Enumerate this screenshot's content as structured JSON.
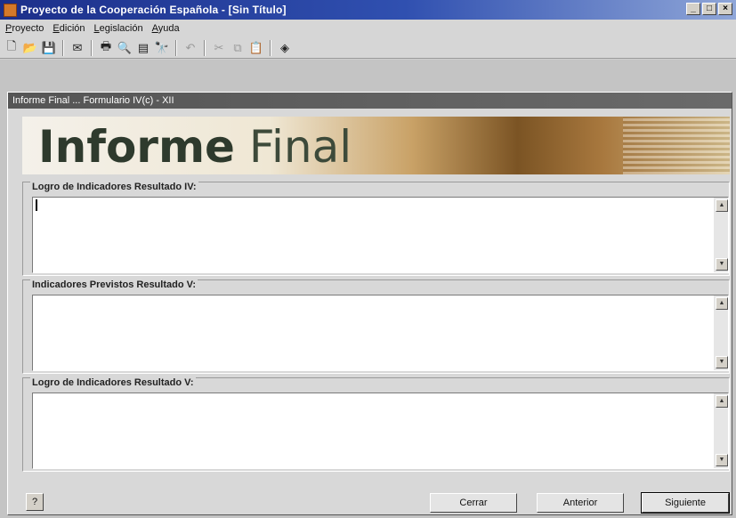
{
  "app": {
    "title": "Proyecto de la Cooperación Española - [Sin Título]"
  },
  "window_buttons": {
    "minimize": "_",
    "maximize": "□",
    "close": "×"
  },
  "menu": [
    "Proyecto",
    "Edición",
    "Legislación",
    "Ayuda"
  ],
  "toolbar": {
    "buttons": [
      {
        "icon": "new-document-icon",
        "glyph": "🗋",
        "enabled": true
      },
      {
        "icon": "open-folder-icon",
        "glyph": "📂",
        "enabled": true
      },
      {
        "icon": "save-icon",
        "glyph": "💾",
        "enabled": true
      },
      {
        "icon": "mail-icon",
        "glyph": "✉",
        "enabled": true
      },
      {
        "icon": "print-icon",
        "glyph": "🖶",
        "enabled": true
      },
      {
        "icon": "print-preview-icon",
        "glyph": "🔍",
        "enabled": true
      },
      {
        "icon": "page-setup-icon",
        "glyph": "▤",
        "enabled": true
      },
      {
        "icon": "find-icon",
        "glyph": "🔭",
        "enabled": true
      },
      {
        "icon": "undo-icon",
        "glyph": "↶",
        "enabled": false
      },
      {
        "icon": "cut-icon",
        "glyph": "✂",
        "enabled": false
      },
      {
        "icon": "copy-icon",
        "glyph": "⧉",
        "enabled": false
      },
      {
        "icon": "paste-icon",
        "glyph": "📋",
        "enabled": false
      },
      {
        "icon": "book-icon",
        "glyph": "◈",
        "enabled": true
      }
    ]
  },
  "form": {
    "window_title": "Informe Final ... Formulario IV(c) - XII",
    "banner": {
      "word1": "Informe",
      "word2": "Final"
    },
    "sections": [
      {
        "label": "Logro de Indicadores Resultado IV:",
        "value": ""
      },
      {
        "label": "Indicadores Previstos Resultado V:",
        "value": ""
      },
      {
        "label": "Logro de Indicadores Resultado V:",
        "value": ""
      }
    ],
    "help_label": "?",
    "buttons": {
      "close": "Cerrar",
      "previous": "Anterior",
      "next": "Siguiente"
    }
  },
  "colors": {
    "titlebar": "#1c2f8a",
    "child_titlebar": "#555555",
    "banner_text": "#2e3a2d"
  }
}
